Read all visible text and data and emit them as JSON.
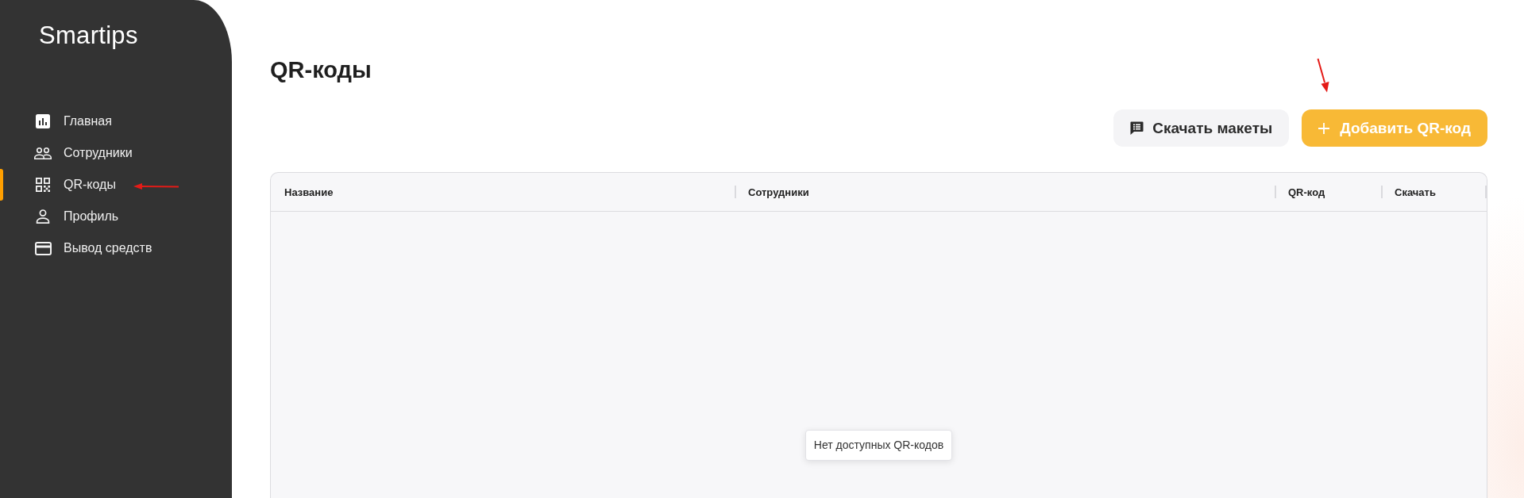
{
  "sidebar": {
    "logo": "Smartips",
    "items": [
      {
        "label": "Главная",
        "selected": false
      },
      {
        "label": "Сотрудники",
        "selected": false
      },
      {
        "label": "QR-коды",
        "selected": true
      },
      {
        "label": "Профиль",
        "selected": false
      },
      {
        "label": "Вывод средств",
        "selected": false
      }
    ]
  },
  "page": {
    "title": "QR-коды",
    "buttons": [
      {
        "kind": "secondary",
        "label": "Скачать макеты"
      },
      {
        "kind": "primary",
        "label": "Добавить QR-код"
      }
    ]
  },
  "table": {
    "columns": [
      "Название",
      "Сотрудники",
      "QR-код",
      "Скачать"
    ],
    "empty_message": "Нет доступных QR-кодов"
  }
}
